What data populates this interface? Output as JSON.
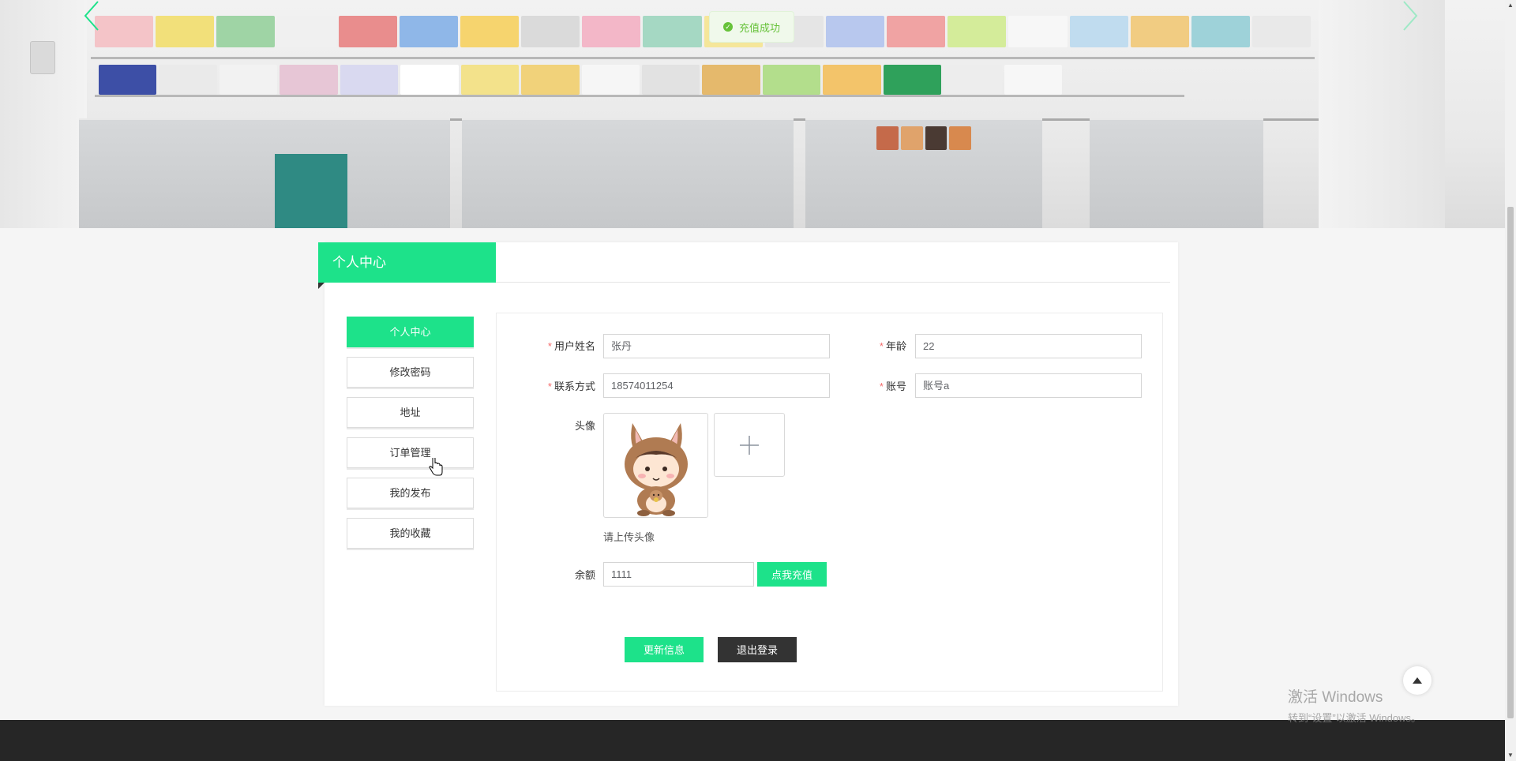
{
  "toast": {
    "text": "充值成功",
    "icon": "check-circle-icon",
    "color": "#67c23a"
  },
  "banner": {
    "prev_icon": "chevron-left-icon",
    "next_icon": "chevron-right-icon",
    "accent": "#1de28a"
  },
  "page": {
    "title": "个人中心"
  },
  "sidebar": {
    "items": [
      {
        "label": "个人中心",
        "active": true
      },
      {
        "label": "修改密码",
        "active": false
      },
      {
        "label": "地址",
        "active": false
      },
      {
        "label": "订单管理",
        "active": false
      },
      {
        "label": "我的发布",
        "active": false
      },
      {
        "label": "我的收藏",
        "active": false
      }
    ]
  },
  "form": {
    "username": {
      "label": "用户姓名",
      "value": "张丹",
      "required": true
    },
    "age": {
      "label": "年龄",
      "value": "22",
      "required": true
    },
    "phone": {
      "label": "联系方式",
      "value": "18574011254",
      "required": true
    },
    "account": {
      "label": "账号",
      "value": "账号a",
      "required": true
    },
    "avatar": {
      "label": "头像",
      "hint": "请上传头像",
      "upload_icon": "plus-icon"
    },
    "balance": {
      "label": "余额",
      "value": "1111",
      "recharge_label": "点我充值"
    },
    "update_label": "更新信息",
    "logout_label": "退出登录"
  },
  "watermark": {
    "line1": "激活 Windows",
    "line2": "转到“设置”以激活 Windows。"
  },
  "colors": {
    "primary": "#1de28a",
    "dark_button": "#333333",
    "footer": "#262626",
    "required": "#f56c6c"
  }
}
